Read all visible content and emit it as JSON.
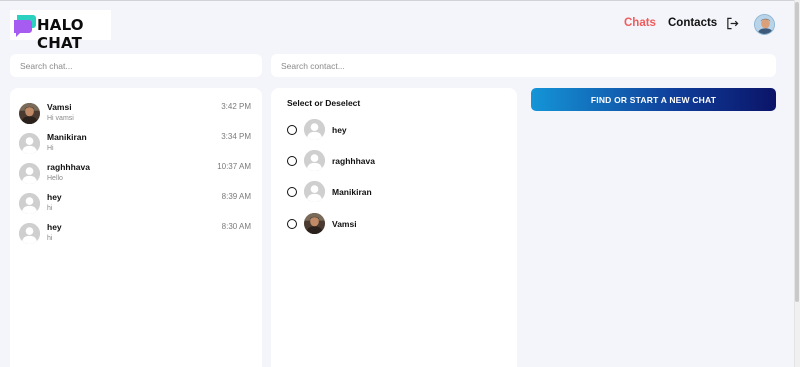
{
  "app": {
    "logo_text": "HALO CHAT",
    "logo_icon": "chat-bubbles-icon"
  },
  "nav": {
    "chats_label": "Chats",
    "contacts_label": "Contacts",
    "logout_icon": "logout-icon",
    "active_color": "#ef5b5b"
  },
  "search": {
    "chat_placeholder": "Search chat...",
    "contact_placeholder": "Search contact..."
  },
  "chats": [
    {
      "name": "Vamsi",
      "message": "Hi vamsi",
      "time": "3:42 PM",
      "avatar": "photo"
    },
    {
      "name": "Manikiran",
      "message": "Hi",
      "time": "3:34 PM",
      "avatar": "default"
    },
    {
      "name": "raghhhava",
      "message": "Hello",
      "time": "10:37 AM",
      "avatar": "default"
    },
    {
      "name": "hey",
      "message": "hi",
      "time": "8:39 AM",
      "avatar": "default"
    },
    {
      "name": "hey",
      "message": "hi",
      "time": "8:30 AM",
      "avatar": "default"
    }
  ],
  "select_panel": {
    "title": "Select or Deselect",
    "contacts": [
      {
        "name": "hey",
        "avatar": "default",
        "selected": false
      },
      {
        "name": "raghhhava",
        "avatar": "default",
        "selected": false
      },
      {
        "name": "Manikiran",
        "avatar": "default",
        "selected": false
      },
      {
        "name": "Vamsi",
        "avatar": "photo",
        "selected": false
      }
    ]
  },
  "new_chat_button": {
    "label": "FIND OR START A NEW CHAT",
    "gradient": [
      "#1595d7",
      "#0f3c98",
      "#0b1468"
    ]
  }
}
